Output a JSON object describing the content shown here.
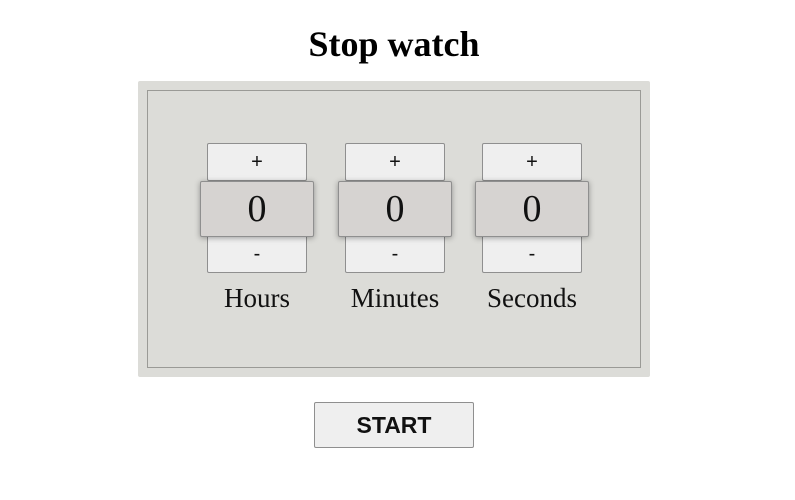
{
  "page": {
    "title": "Stop watch"
  },
  "timer": {
    "hours": {
      "increment_label": "+",
      "value": "0",
      "decrement_label": "-",
      "label": "Hours"
    },
    "minutes": {
      "increment_label": "+",
      "value": "0",
      "decrement_label": "-",
      "label": "Minutes"
    },
    "seconds": {
      "increment_label": "+",
      "value": "0",
      "decrement_label": "-",
      "label": "Seconds"
    }
  },
  "controls": {
    "start_label": "START"
  },
  "colors": {
    "panel_background": "#dcdcd8",
    "value_background": "#d6d3d1",
    "button_background": "#efefef"
  }
}
